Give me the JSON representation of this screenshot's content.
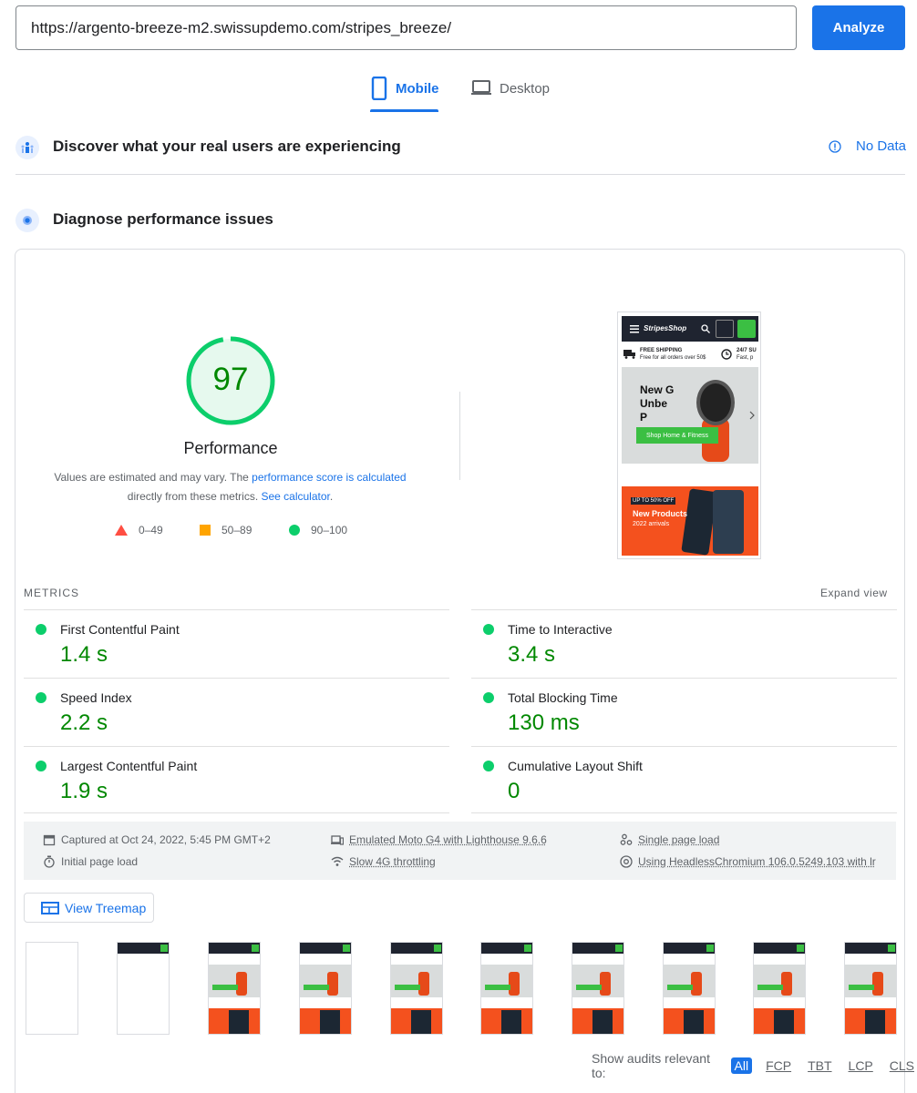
{
  "search": {
    "url": "https://argento-breeze-m2.swissupdemo.com/stripes_breeze/"
  },
  "analyze_label": "Analyze",
  "tabs": {
    "mobile": "Mobile",
    "desktop": "Desktop"
  },
  "field_data": {
    "title": "Discover what your real users are experiencing",
    "status": "No Data"
  },
  "diagnose": {
    "title": "Diagnose performance issues"
  },
  "performance": {
    "score": "97",
    "score_fraction": 0.97,
    "title": "Performance",
    "desc_1": "Values are estimated and may vary. The ",
    "desc_link_1": "performance score is calculated",
    "desc_2": "directly from these metrics. ",
    "desc_link_2": "See calculator",
    "desc_3": ".",
    "legend": {
      "fail": "0–49",
      "average": "50–89",
      "pass": "90–100"
    },
    "colors": {
      "pass": "#0cce6b",
      "average": "#ffa400",
      "fail": "#ff4e42"
    }
  },
  "screenshot": {
    "logo": "StripesShop",
    "shipping_title": "FREE SHIPPING",
    "shipping_sub": "Free for all orders over 50$",
    "support_title": "24/7 SU",
    "support_sub": "Fast, p",
    "hero_title_1": "New G",
    "hero_title_2": "Unbe",
    "hero_title_3": "P",
    "hero_button": "Shop Home & Fitness",
    "promo_tag": "UP TO 50% OFF",
    "promo_title": "New Products",
    "promo_sub": "2022 arrivals"
  },
  "metrics": {
    "label": "METRICS",
    "expand": "Expand view",
    "items": [
      {
        "name": "First Contentful Paint",
        "value": "1.4 s"
      },
      {
        "name": "Time to Interactive",
        "value": "3.4 s"
      },
      {
        "name": "Speed Index",
        "value": "2.2 s"
      },
      {
        "name": "Total Blocking Time",
        "value": "130 ms"
      },
      {
        "name": "Largest Contentful Paint",
        "value": "1.9 s"
      },
      {
        "name": "Cumulative Layout Shift",
        "value": "0"
      }
    ]
  },
  "info": {
    "captured": "Captured at Oct 24, 2022, 5:45 PM GMT+2",
    "initial": "Initial page load",
    "device": "Emulated Moto G4 with Lighthouse 9.6.6",
    "throttling": "Slow 4G throttling",
    "session": "Single page load",
    "browser": "Using HeadlessChromium 106.0.5249.103 with lr"
  },
  "treemap_label": "View Treemap",
  "audits": {
    "label": "Show audits relevant to:",
    "filters": [
      "All",
      "FCP",
      "TBT",
      "LCP",
      "CLS"
    ]
  }
}
